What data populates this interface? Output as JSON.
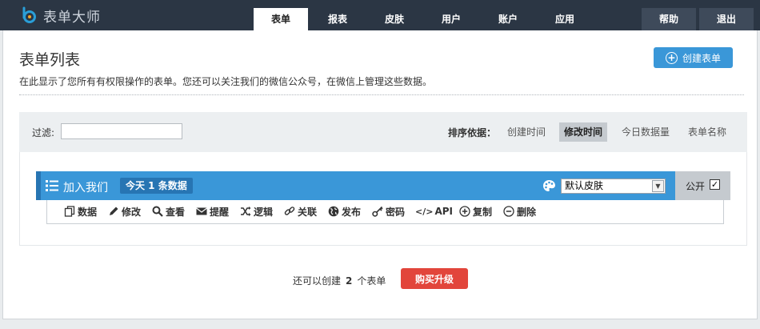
{
  "app": {
    "logo_text": "表单大师"
  },
  "nav": {
    "tabs": [
      "表单",
      "报表",
      "皮肤",
      "用户",
      "账户",
      "应用"
    ],
    "help": "帮助",
    "logout": "退出"
  },
  "page": {
    "title": "表单列表",
    "desc": "在此显示了您所有有权限操作的表单。您还可以关注我们的微信公众号，在微信上管理这些数据。",
    "create_label": "创建表单"
  },
  "filter": {
    "label": "过滤:",
    "value": "",
    "sort_label": "排序依据：",
    "sort_options": [
      "创建时间",
      "修改时间",
      "今日数据量",
      "表单名称"
    ],
    "sort_active": "修改时间"
  },
  "form": {
    "name": "加入我们",
    "today_badge": "今天 1 条数据",
    "skin_value": "默认皮肤",
    "public_label": "公开",
    "public_checked": true,
    "actions": [
      {
        "icon": "copy-icon",
        "label": "数据"
      },
      {
        "icon": "pencil-icon",
        "label": "修改"
      },
      {
        "icon": "search-icon",
        "label": "查看"
      },
      {
        "icon": "envelope-icon",
        "label": "提醒"
      },
      {
        "icon": "shuffle-icon",
        "label": "逻辑"
      },
      {
        "icon": "link-icon",
        "label": "关联"
      },
      {
        "icon": "globe-icon",
        "label": "发布"
      },
      {
        "icon": "key-icon",
        "label": "密码"
      },
      {
        "icon": "code-icon",
        "label": "API"
      },
      {
        "icon": "plus-circle-icon",
        "label": "复制"
      },
      {
        "icon": "minus-circle-icon",
        "label": "删除"
      }
    ]
  },
  "footer": {
    "remain_prefix": "还可以创建",
    "remain_count": "2",
    "remain_suffix": "个表单",
    "upgrade_label": "购买升级"
  },
  "colors": {
    "topbar": "#2b3644",
    "accent": "#3a97d8",
    "accent_dark": "#2775b3",
    "danger": "#e2453b"
  }
}
